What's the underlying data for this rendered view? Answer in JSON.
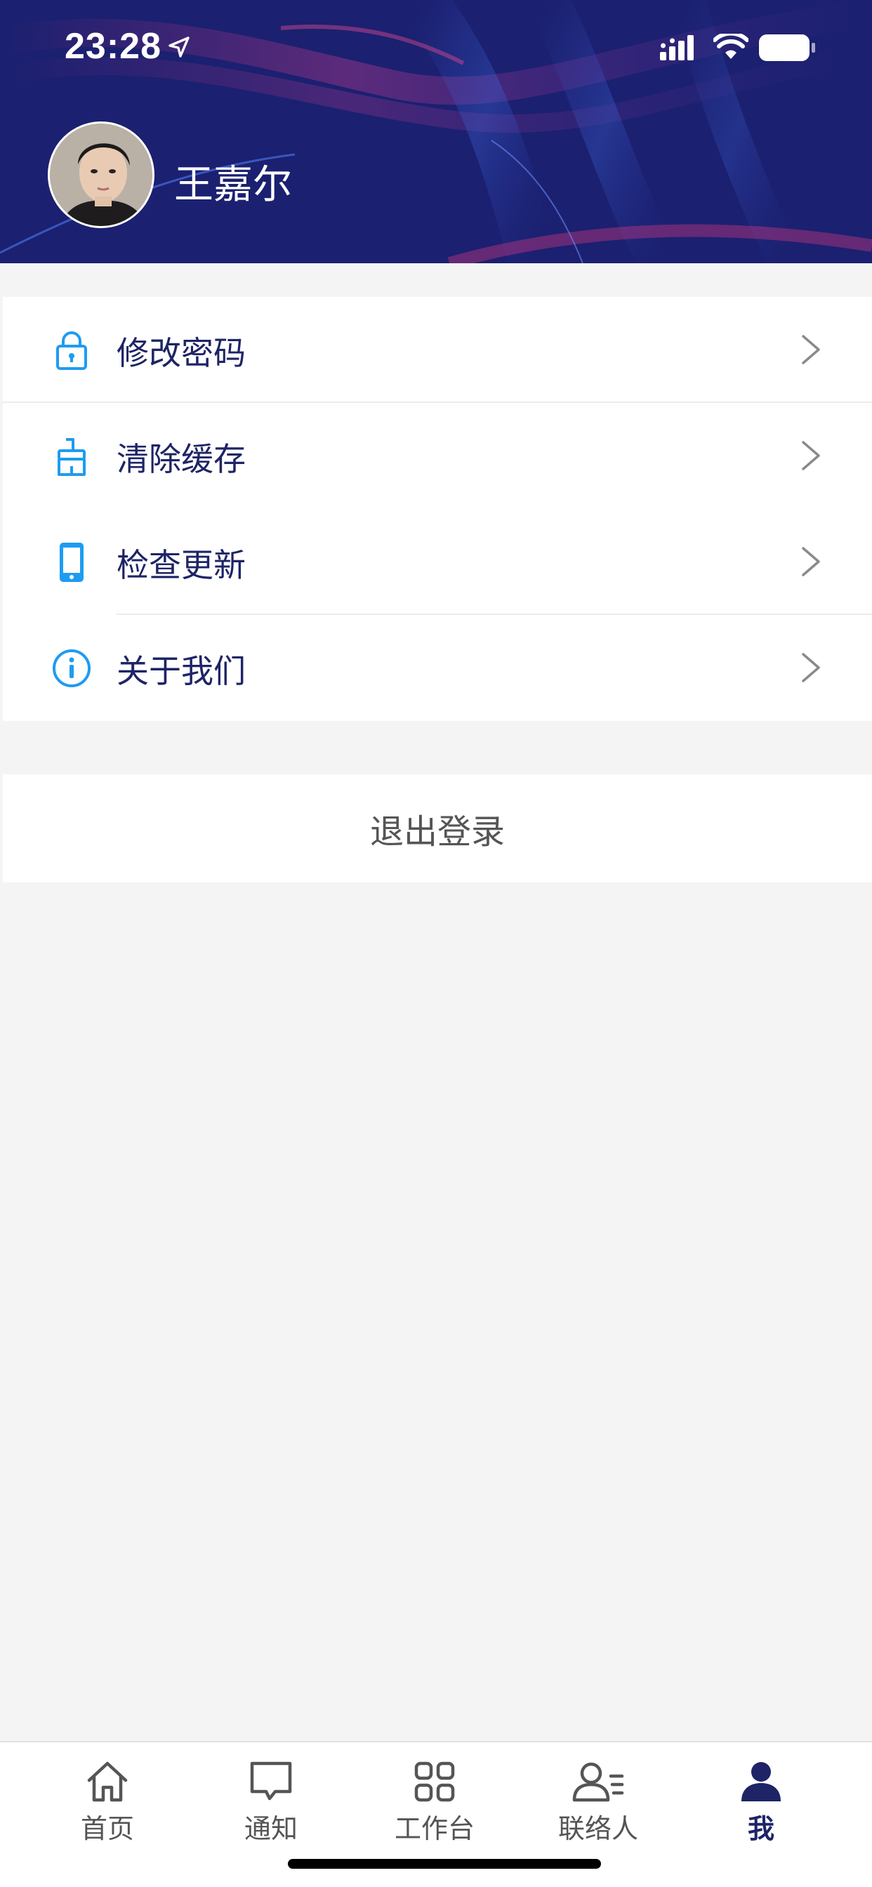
{
  "status_bar": {
    "time": "23:28"
  },
  "profile": {
    "name": "王嘉尔"
  },
  "menu": {
    "items": [
      {
        "label": "修改密码",
        "icon": "lock-icon"
      },
      {
        "label": "清除缓存",
        "icon": "brush-icon"
      },
      {
        "label": "检查更新",
        "icon": "phone-icon"
      },
      {
        "label": "关于我们",
        "icon": "info-icon"
      }
    ]
  },
  "logout": {
    "label": "退出登录"
  },
  "tabbar": {
    "tabs": [
      {
        "label": "首页",
        "icon": "home-icon",
        "active": false
      },
      {
        "label": "通知",
        "icon": "message-icon",
        "active": false
      },
      {
        "label": "工作台",
        "icon": "grid-icon",
        "active": false
      },
      {
        "label": "联络人",
        "icon": "contacts-icon",
        "active": false
      },
      {
        "label": "我",
        "icon": "person-icon",
        "active": true
      }
    ]
  },
  "colors": {
    "accent": "#1e2466",
    "icon_blue": "#1e9cf0",
    "header_bg": "#1f2478"
  }
}
